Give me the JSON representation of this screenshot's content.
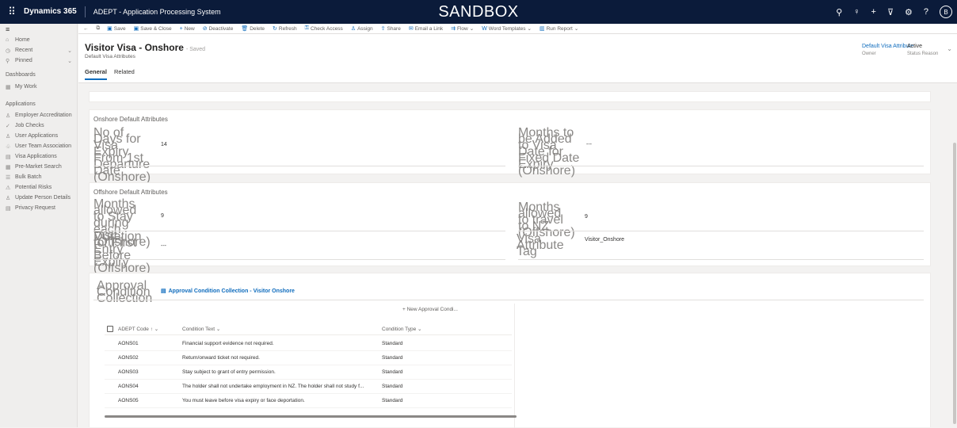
{
  "topbar": {
    "brand": "Dynamics 365",
    "app_name": "ADEPT - Application Processing System",
    "environment": "SANDBOX",
    "avatar_initial": "B",
    "icons": [
      "search-icon",
      "lightbulb-icon",
      "plus-icon",
      "filter-icon",
      "gear-icon",
      "help-icon"
    ]
  },
  "sidebar": {
    "top_items": [
      {
        "icon": "home-icon",
        "label": "Home"
      },
      {
        "icon": "recent-icon",
        "label": "Recent"
      },
      {
        "icon": "pinned-icon",
        "label": "Pinned"
      }
    ],
    "dashboards_header": "Dashboards",
    "dashboard_items": [
      {
        "icon": "dashboard-icon",
        "label": "My Work"
      }
    ],
    "applications_header": "Applications",
    "application_items": [
      {
        "icon": "person-icon",
        "label": "Employer Accreditation"
      },
      {
        "icon": "check-icon",
        "label": "Job Checks"
      },
      {
        "icon": "person-icon",
        "label": "User Applications"
      },
      {
        "icon": "team-icon",
        "label": "User Team Association"
      },
      {
        "icon": "document-icon",
        "label": "Visa Applications"
      },
      {
        "icon": "calendar-icon",
        "label": "Pre-Market Search"
      },
      {
        "icon": "list-icon",
        "label": "Bulk Batch"
      },
      {
        "icon": "warning-icon",
        "label": "Potential Risks"
      },
      {
        "icon": "person-icon",
        "label": "Update Person Details"
      },
      {
        "icon": "document-icon",
        "label": "Privacy Request"
      }
    ]
  },
  "commandbar": {
    "items": [
      {
        "icon": "save-icon",
        "label": "Save"
      },
      {
        "icon": "save-close-icon",
        "label": "Save & Close"
      },
      {
        "icon": "new-icon",
        "label": "New"
      },
      {
        "icon": "deactivate-icon",
        "label": "Deactivate"
      },
      {
        "icon": "delete-icon",
        "label": "Delete"
      },
      {
        "icon": "refresh-icon",
        "label": "Refresh"
      },
      {
        "icon": "check-access-icon",
        "label": "Check Access"
      },
      {
        "icon": "assign-icon",
        "label": "Assign"
      },
      {
        "icon": "share-icon",
        "label": "Share"
      },
      {
        "icon": "email-icon",
        "label": "Email a Link"
      },
      {
        "icon": "flow-icon",
        "label": "Flow"
      },
      {
        "icon": "word-icon",
        "label": "Word Templates"
      },
      {
        "icon": "report-icon",
        "label": "Run Report"
      }
    ]
  },
  "header": {
    "title": "Visitor Visa - Onshore",
    "saved_label": "- Saved",
    "subtitle": "Default Visa Attributes",
    "fields": [
      {
        "value": "Default Visa Attribute",
        "label": "Owner"
      },
      {
        "value": "Active",
        "label": "Status Reason"
      }
    ],
    "tabs": [
      {
        "label": "General",
        "active": true
      },
      {
        "label": "Related",
        "active": false
      }
    ]
  },
  "onshore": {
    "title": "Onshore Default Attributes",
    "left": {
      "label": "No of Days for Visa Expiry From 1st Departure Date (Onshore)",
      "value": "14"
    },
    "right": {
      "label": "Months to be Added to Visa Date for Fixed Date Expiry (Onshore)",
      "value": "---"
    }
  },
  "offshore": {
    "title": "Offshore Default Attributes",
    "left1": {
      "label": "Months allowed to Stay during each Visit (Offshore)",
      "value": "9"
    },
    "left2": {
      "label": "Duration for First Entry Before Expiry (Offshore)",
      "value": "---"
    },
    "right1": {
      "label": "Months allowed to travel to NZ (Offshore)",
      "value": "9"
    },
    "right2": {
      "label": "Visa Attribute Tag",
      "value": "Visitor_Onshore"
    }
  },
  "conditions": {
    "label": "Approval Condition Collection",
    "link": "Approval Condition Collection - Visitor Onshore",
    "new_button": "New Approval Condi...",
    "columns": [
      "ADEPT Code",
      "Condition Text",
      "Condition Type"
    ],
    "rows": [
      {
        "code": "AONS01",
        "text": "Financial support evidence not required.",
        "type": "Standard"
      },
      {
        "code": "AONS02",
        "text": "Return/onward ticket not required.",
        "type": "Standard"
      },
      {
        "code": "AONS03",
        "text": "Stay subject to grant of entry permission.",
        "type": "Standard"
      },
      {
        "code": "AONS04",
        "text": "The holder shall not undertake employment in NZ. The holder shall not study f...",
        "type": "Standard"
      },
      {
        "code": "AONS05",
        "text": "You must leave before visa expiry or face deportation.",
        "type": "Standard"
      }
    ]
  }
}
